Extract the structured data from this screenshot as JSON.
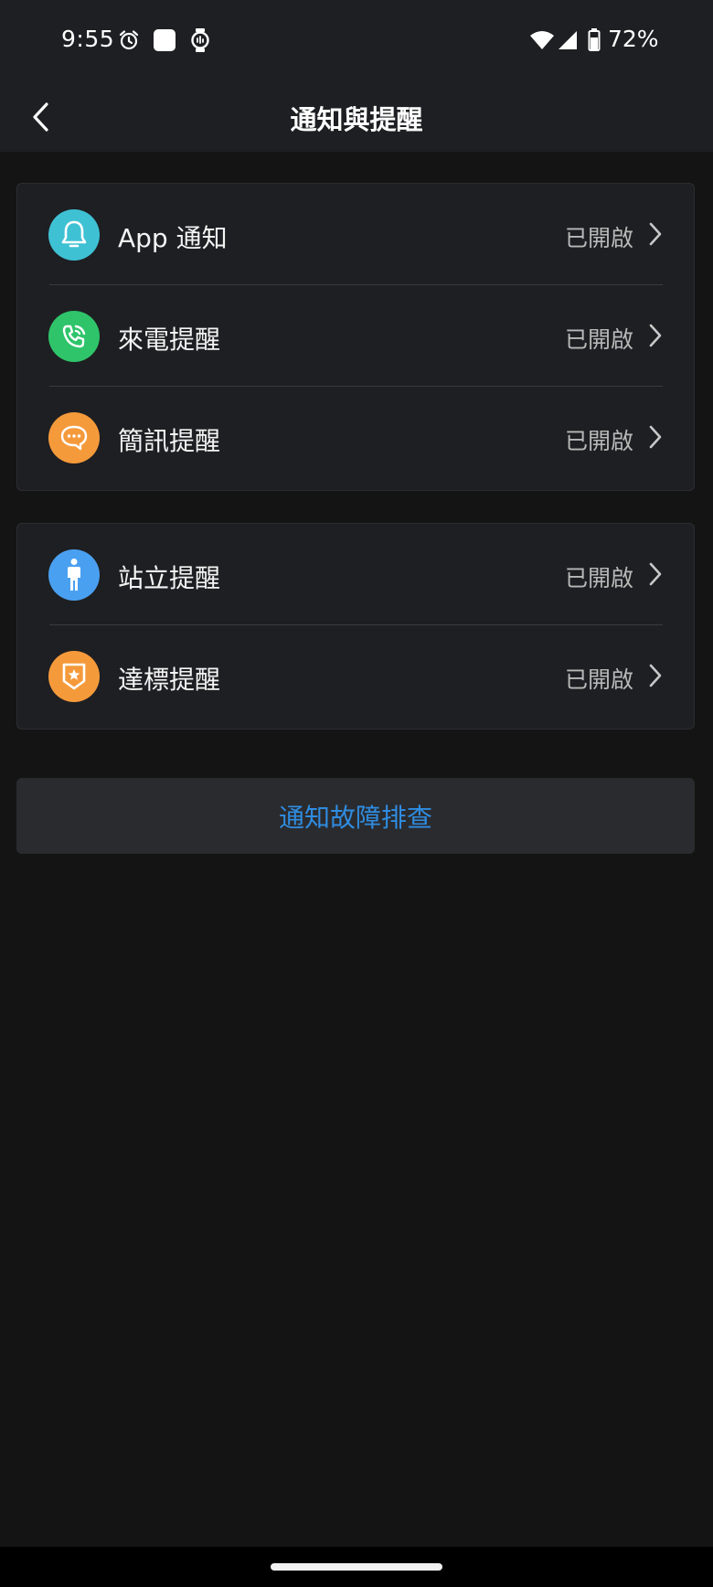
{
  "status_bar": {
    "time": "9:55",
    "battery": "72%",
    "icons": [
      "alarm-icon",
      "square-app-icon",
      "watch-icon",
      "wifi-icon",
      "signal-icon",
      "battery-icon"
    ]
  },
  "header": {
    "title": "通知與提醒",
    "back_icon": "chevron-left-icon"
  },
  "groups": [
    {
      "items": [
        {
          "label": "App 通知",
          "status": "已開啟",
          "icon": "bell-icon",
          "color": "#3fc1d4"
        },
        {
          "label": "來電提醒",
          "status": "已開啟",
          "icon": "phone-icon",
          "color": "#2fc46a"
        },
        {
          "label": "簡訊提醒",
          "status": "已開啟",
          "icon": "message-icon",
          "color": "#f59a3b"
        }
      ]
    },
    {
      "items": [
        {
          "label": "站立提醒",
          "status": "已開啟",
          "icon": "standing-person-icon",
          "color": "#4aa0f0"
        },
        {
          "label": "達標提醒",
          "status": "已開啟",
          "icon": "badge-icon",
          "color": "#f59a3b"
        }
      ]
    }
  ],
  "troubleshoot": {
    "label": "通知故障排查",
    "color": "#2f8ce0"
  }
}
